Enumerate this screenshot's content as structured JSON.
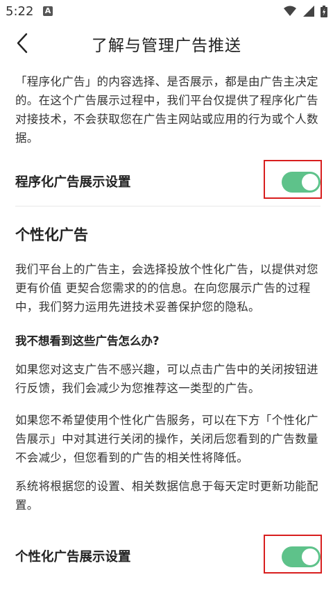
{
  "status_bar": {
    "time": "5:22",
    "notification_badge": "A",
    "icons": [
      "wifi-icon",
      "signal-icon",
      "battery-icon"
    ]
  },
  "app_bar": {
    "title": "了解与管理广告推送",
    "back_icon": "chevron-left-icon"
  },
  "intro": {
    "text": "「程序化广告」的内容选择、是否展示，都是由广告主决定的。在这个广告展示过程中，我们平台仅提供了程序化广告对接技术，不会获取您在广告主网站或应用的行为或个人数据。"
  },
  "programmatic_setting": {
    "label": "程序化广告展示设置",
    "enabled": true
  },
  "personalized": {
    "title": "个性化广告",
    "para1": "我们平台上的广告主，会选择投放个性化广告，以提供对您更有价值 更契合您需求的的信息。在向您展示广告的过程中，我们努力运用先进技术妥善保护您的隐私。",
    "question": "我不想看到这些广告怎么办?",
    "para2": "如果您对这支广告不感兴趣，可以点击广告中的关闭按钮进行反馈，我们会减少为您推荐这一类型的广告。",
    "para3": "如果您不希望使用个性化广告服务，可以在下方「个性化广告展示」中对其进行关闭的操作，关闭后您看到的广告数量不会减少，但您看到的广告的相关性将降低。",
    "para4": "系统将根据您的设置、相关数据信息于每天定时更新功能配置。"
  },
  "personalized_setting": {
    "label": "个性化广告展示设置",
    "enabled": true
  },
  "colors": {
    "toggle_on": "#5ec28a",
    "highlight_border": "#d81e1e"
  }
}
